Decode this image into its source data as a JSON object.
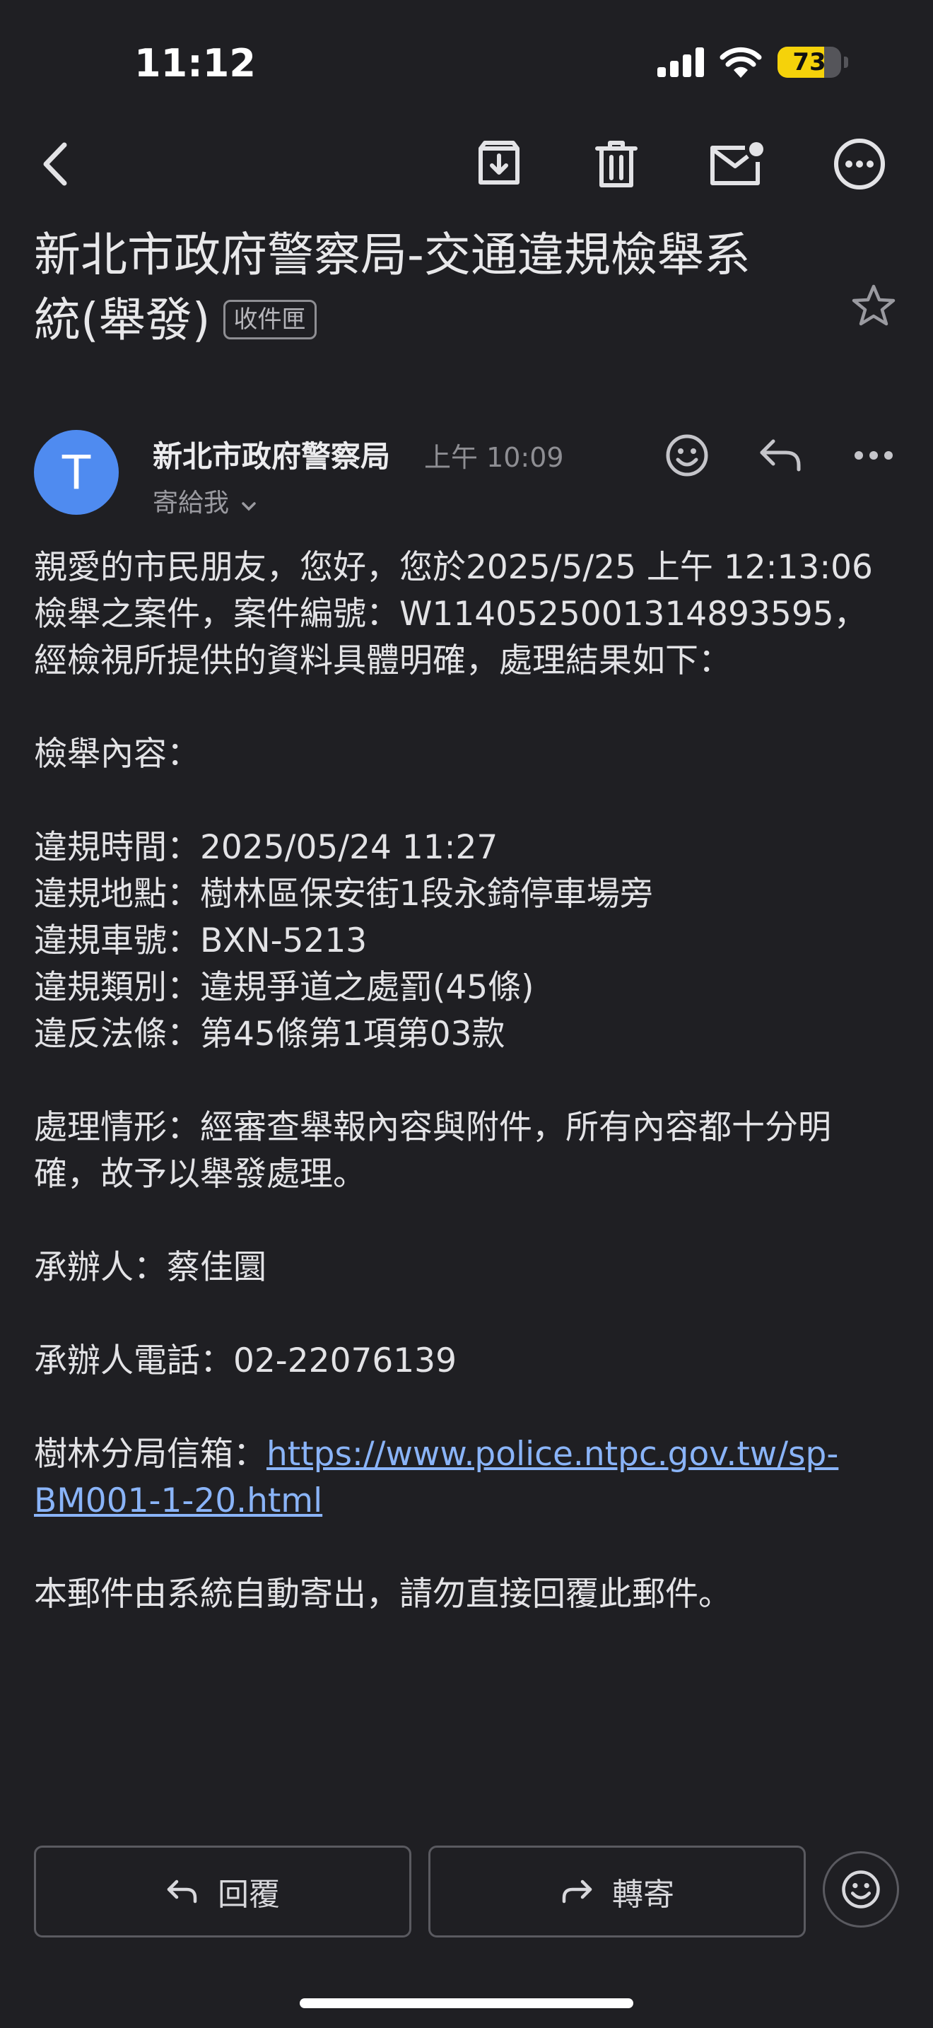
{
  "status_bar": {
    "time": "11:12",
    "battery": "73",
    "battery_level": 0.73
  },
  "toolbar": {
    "icons": [
      "back-icon",
      "archive-icon",
      "delete-icon",
      "mark-unread-icon",
      "more-icon"
    ]
  },
  "email": {
    "subject_line1": "新北市政府警察局-交通違規檢舉系",
    "subject_line2": "統(舉發)",
    "label": "收件匣",
    "sender_initial": "T",
    "sender_name": "新北市政府警察局",
    "time": "上午 10:09",
    "to": "寄給我"
  },
  "body": {
    "intro1": "親愛的市民朋友，您好，您於2025/5/25 上午 12:13:06",
    "intro2": "檢舉之案件，案件編號：W1140525001314893595，",
    "intro3": "經檢視所提供的資料具體明確，處理結果如下：",
    "content_heading": "檢舉內容：",
    "violation_time": "違規時間：2025/05/24 11:27",
    "violation_place": "違規地點：樹林區保安街1段永錡停車場旁",
    "plate": "違規車號：BXN-5213",
    "category": "違規類別：違規爭道之處罰(45條)",
    "law": "違反法條：第45條第1項第03款",
    "handling1": "處理情形：經審查舉報內容與附件，所有內容都十分明",
    "handling2": "確，故予以舉發處理。",
    "officer": "承辦人：蔡佳圜",
    "phone": "承辦人電話：02-22076139",
    "mailbox_label": "樹林分局信箱：",
    "mailbox_link1": "https://www.police.ntpc.gov.tw/sp-",
    "mailbox_link2": "BM001-1-20.html",
    "footer": "本郵件由系統自動寄出，請勿直接回覆此郵件。"
  },
  "actions": {
    "reply": "回覆",
    "forward": "轉寄"
  },
  "colors": {
    "background": "#1f1f23",
    "avatar": "#4f8bf0",
    "link": "#8ab4f8",
    "battery": "#f5d20a"
  }
}
